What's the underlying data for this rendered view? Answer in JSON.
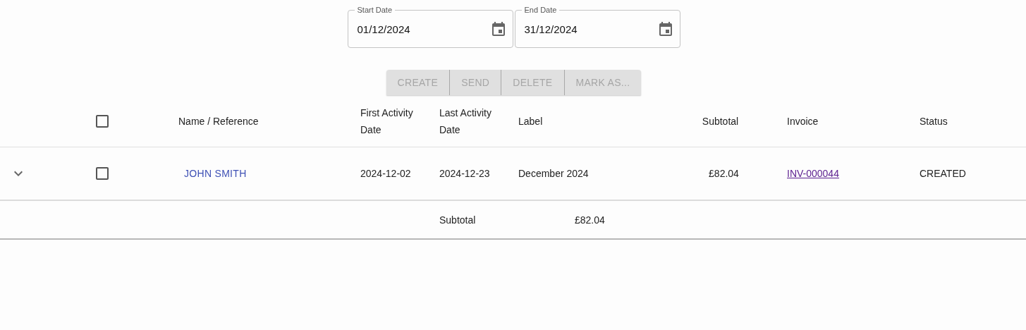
{
  "date_range": [
    {
      "label": "Start Date",
      "value": "01/12/2024"
    },
    {
      "label": "End Date",
      "value": "31/12/2024"
    }
  ],
  "actions": [
    {
      "label": "CREATE",
      "disabled": true
    },
    {
      "label": "SEND",
      "disabled": true
    },
    {
      "label": "DELETE",
      "disabled": true
    },
    {
      "label": "MARK AS...",
      "disabled": true
    }
  ],
  "table": {
    "select_all_checked": false,
    "columns": [
      "Name / Reference",
      "First Activity Date",
      "Last Activity Date",
      "Label",
      "Subtotal",
      "Invoice",
      "Status"
    ],
    "rows": [
      {
        "expanded": false,
        "checked": false,
        "name": "JOHN SMITH",
        "first_activity": "2024-12-02",
        "last_activity": "2024-12-23",
        "label": "December 2024",
        "subtotal": "£82.04",
        "invoice": "INV-000044",
        "status": "CREATED"
      }
    ],
    "footer": {
      "label": "Subtotal",
      "value": "£82.04"
    }
  }
}
